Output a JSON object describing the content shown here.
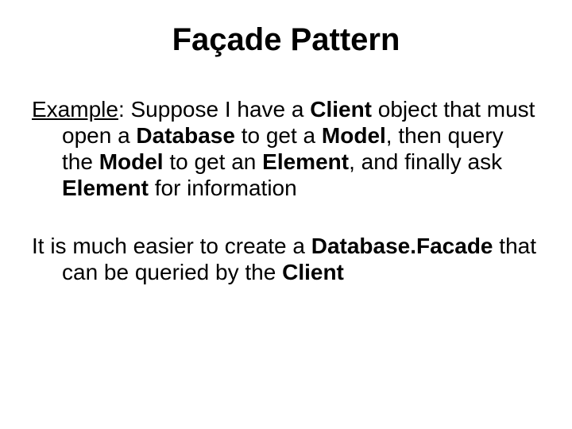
{
  "title": "Façade Pattern",
  "p1": {
    "lead_underlined": "Example",
    "t1": ": Suppose I have a ",
    "client": "Client",
    "t2": " object that must open a ",
    "database": "Database",
    "t3": " to get a ",
    "model": "Model",
    "t4": ", then query the ",
    "model2": "Model",
    "t5": " to get an ",
    "element": "Element",
    "t6": ", and finally ask ",
    "element2": "Element",
    "t7": " for information"
  },
  "p2": {
    "t1": "It is much easier to create a ",
    "database_facade": "Database.Facade",
    "t2": " that can be queried by the ",
    "client": "Client"
  }
}
